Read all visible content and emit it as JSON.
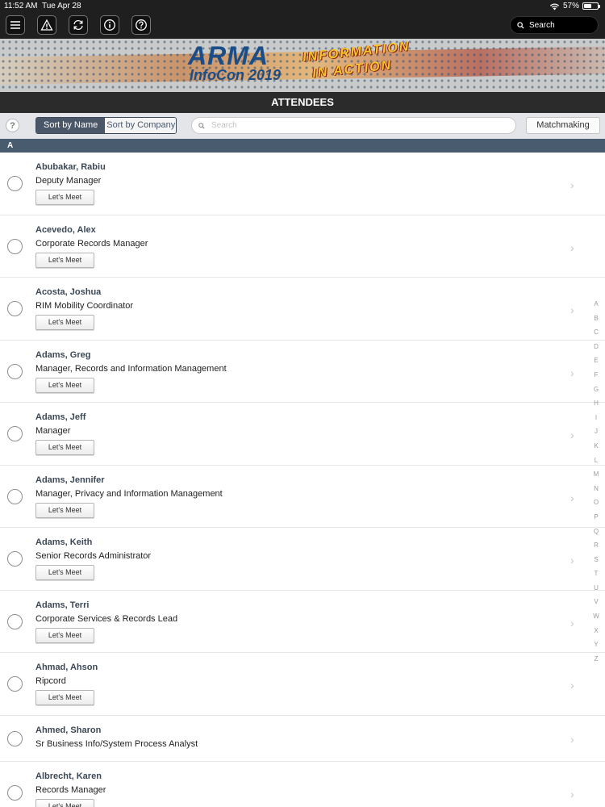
{
  "status": {
    "time": "11:52 AM",
    "date": "Tue Apr 28",
    "battery": "57%",
    "battery_level": 0.57
  },
  "toolbar": {
    "icons": [
      "menu-icon",
      "warning-icon",
      "refresh-icon",
      "info-icon",
      "help-icon"
    ],
    "search_label": "Search"
  },
  "banner": {
    "brand_line1": "ARMA",
    "brand_line2": "InfoCon 2019",
    "tagline_line1": "INFORMATION",
    "tagline_line2": "IN ACTION"
  },
  "header": {
    "title": "ATTENDEES"
  },
  "controls": {
    "help": "?",
    "sort_by_name": "Sort by Name",
    "sort_by_company": "Sort by Company",
    "search_placeholder": "Search",
    "matchmaking": "Matchmaking"
  },
  "section_letter": "A",
  "attendees": [
    {
      "name": "Abubakar, Rabiu",
      "title": "Deputy Manager",
      "action": "Let's Meet"
    },
    {
      "name": "Acevedo, Alex",
      "title": "Corporate Records Manager",
      "action": "Let's Meet"
    },
    {
      "name": "Acosta, Joshua",
      "title": "RIM Mobility Coordinator",
      "action": "Let's Meet"
    },
    {
      "name": "Adams, Greg",
      "title": "Manager, Records and Information Management",
      "action": "Let's Meet"
    },
    {
      "name": "Adams, Jeff",
      "title": "Manager",
      "action": "Let's Meet"
    },
    {
      "name": "Adams, Jennifer",
      "title": "Manager, Privacy and Information Management",
      "action": "Let's Meet"
    },
    {
      "name": "Adams, Keith",
      "title": "Senior Records Administrator",
      "action": "Let's Meet"
    },
    {
      "name": "Adams, Terri",
      "title": "Corporate Services & Records Lead",
      "action": "Let's Meet"
    },
    {
      "name": "Ahmad, Ahson",
      "title": "Ripcord",
      "action": "Let's Meet"
    },
    {
      "name": "Ahmed, Sharon",
      "title": "Sr Business Info/System Process Analyst",
      "action": ""
    },
    {
      "name": "Albrecht, Karen",
      "title": "Records Manager",
      "action": "Let's Meet"
    }
  ],
  "index_letters": [
    "A",
    "B",
    "C",
    "D",
    "E",
    "F",
    "G",
    "H",
    "I",
    "J",
    "K",
    "L",
    "M",
    "N",
    "O",
    "P",
    "Q",
    "R",
    "S",
    "T",
    "U",
    "V",
    "W",
    "X",
    "Y",
    "Z"
  ],
  "colors": {
    "section_header": "#495b6f",
    "toolbar": "#1f1f1f",
    "accent": "#4a5769"
  }
}
